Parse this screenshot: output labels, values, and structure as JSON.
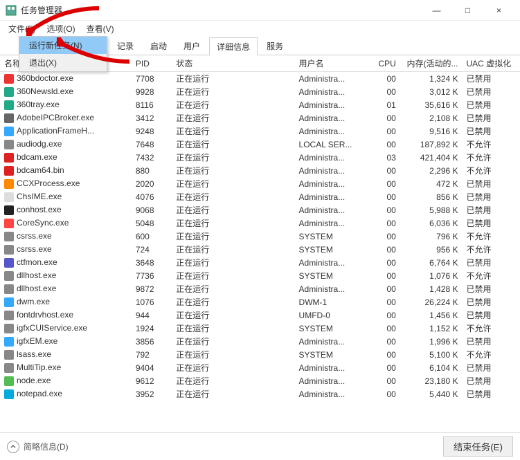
{
  "window": {
    "title": "任务管理器",
    "minimize": "—",
    "maximize": "□",
    "close": "×"
  },
  "menubar": {
    "file": "文件(F)",
    "options": "选项(O)",
    "view": "查看(V)"
  },
  "dropdown": {
    "run_new": "运行新任务(N)",
    "exit": "退出(X)"
  },
  "tabs": {
    "history_partial": "记录",
    "startup": "启动",
    "users": "用户",
    "details": "详细信息",
    "services": "服务"
  },
  "columns": {
    "name": "名称",
    "pid": "PID",
    "status": "状态",
    "user": "用户名",
    "cpu": "CPU",
    "mem": "内存(活动的...",
    "uac": "UAC 虚拟化"
  },
  "status_running": "正在运行",
  "processes": [
    {
      "icon": "#e33",
      "name": "360bdoctor.exe",
      "pid": "7708",
      "user": "Administra...",
      "cpu": "00",
      "mem": "1,324 K",
      "uac": "已禁用"
    },
    {
      "icon": "#2a8",
      "name": "360Newsld.exe",
      "pid": "9928",
      "user": "Administra...",
      "cpu": "00",
      "mem": "3,012 K",
      "uac": "已禁用"
    },
    {
      "icon": "#2a8",
      "name": "360tray.exe",
      "pid": "8116",
      "user": "Administra...",
      "cpu": "01",
      "mem": "35,616 K",
      "uac": "已禁用"
    },
    {
      "icon": "#666",
      "name": "AdobeIPCBroker.exe",
      "pid": "3412",
      "user": "Administra...",
      "cpu": "00",
      "mem": "2,108 K",
      "uac": "已禁用"
    },
    {
      "icon": "#3af",
      "name": "ApplicationFrameH...",
      "pid": "9248",
      "user": "Administra...",
      "cpu": "00",
      "mem": "9,516 K",
      "uac": "已禁用"
    },
    {
      "icon": "#888",
      "name": "audiodg.exe",
      "pid": "7648",
      "user": "LOCAL SER...",
      "cpu": "00",
      "mem": "187,892 K",
      "uac": "不允许"
    },
    {
      "icon": "#d22",
      "name": "bdcam.exe",
      "pid": "7432",
      "user": "Administra...",
      "cpu": "03",
      "mem": "421,404 K",
      "uac": "不允许"
    },
    {
      "icon": "#d22",
      "name": "bdcam64.bin",
      "pid": "880",
      "user": "Administra...",
      "cpu": "00",
      "mem": "2,296 K",
      "uac": "不允许"
    },
    {
      "icon": "#f80",
      "name": "CCXProcess.exe",
      "pid": "2020",
      "user": "Administra...",
      "cpu": "00",
      "mem": "472 K",
      "uac": "已禁用"
    },
    {
      "icon": "#ddd",
      "name": "ChsIME.exe",
      "pid": "4076",
      "user": "Administra...",
      "cpu": "00",
      "mem": "856 K",
      "uac": "已禁用"
    },
    {
      "icon": "#222",
      "name": "conhost.exe",
      "pid": "9068",
      "user": "Administra...",
      "cpu": "00",
      "mem": "5,988 K",
      "uac": "已禁用"
    },
    {
      "icon": "#f44",
      "name": "CoreSync.exe",
      "pid": "5048",
      "user": "Administra...",
      "cpu": "00",
      "mem": "6,036 K",
      "uac": "已禁用"
    },
    {
      "icon": "#888",
      "name": "csrss.exe",
      "pid": "600",
      "user": "SYSTEM",
      "cpu": "00",
      "mem": "796 K",
      "uac": "不允许"
    },
    {
      "icon": "#888",
      "name": "csrss.exe",
      "pid": "724",
      "user": "SYSTEM",
      "cpu": "00",
      "mem": "956 K",
      "uac": "不允许"
    },
    {
      "icon": "#55c",
      "name": "ctfmon.exe",
      "pid": "3648",
      "user": "Administra...",
      "cpu": "00",
      "mem": "6,764 K",
      "uac": "已禁用"
    },
    {
      "icon": "#888",
      "name": "dllhost.exe",
      "pid": "7736",
      "user": "SYSTEM",
      "cpu": "00",
      "mem": "1,076 K",
      "uac": "不允许"
    },
    {
      "icon": "#888",
      "name": "dllhost.exe",
      "pid": "9872",
      "user": "Administra...",
      "cpu": "00",
      "mem": "1,428 K",
      "uac": "已禁用"
    },
    {
      "icon": "#3af",
      "name": "dwm.exe",
      "pid": "1076",
      "user": "DWM-1",
      "cpu": "00",
      "mem": "26,224 K",
      "uac": "已禁用"
    },
    {
      "icon": "#888",
      "name": "fontdrvhost.exe",
      "pid": "944",
      "user": "UMFD-0",
      "cpu": "00",
      "mem": "1,456 K",
      "uac": "已禁用"
    },
    {
      "icon": "#888",
      "name": "igfxCUIService.exe",
      "pid": "1924",
      "user": "SYSTEM",
      "cpu": "00",
      "mem": "1,152 K",
      "uac": "不允许"
    },
    {
      "icon": "#3af",
      "name": "igfxEM.exe",
      "pid": "3856",
      "user": "Administra...",
      "cpu": "00",
      "mem": "1,996 K",
      "uac": "已禁用"
    },
    {
      "icon": "#888",
      "name": "lsass.exe",
      "pid": "792",
      "user": "SYSTEM",
      "cpu": "00",
      "mem": "5,100 K",
      "uac": "不允许"
    },
    {
      "icon": "#888",
      "name": "MultiTip.exe",
      "pid": "9404",
      "user": "Administra...",
      "cpu": "00",
      "mem": "6,104 K",
      "uac": "已禁用"
    },
    {
      "icon": "#5b5",
      "name": "node.exe",
      "pid": "9612",
      "user": "Administra...",
      "cpu": "00",
      "mem": "23,180 K",
      "uac": "已禁用"
    },
    {
      "icon": "#0ad",
      "name": "notepad.exe",
      "pid": "3952",
      "user": "Administra...",
      "cpu": "00",
      "mem": "5,440 K",
      "uac": "已禁用"
    }
  ],
  "statusbar": {
    "fewer_details": "简略信息(D)",
    "end_task": "结束任务(E)"
  }
}
